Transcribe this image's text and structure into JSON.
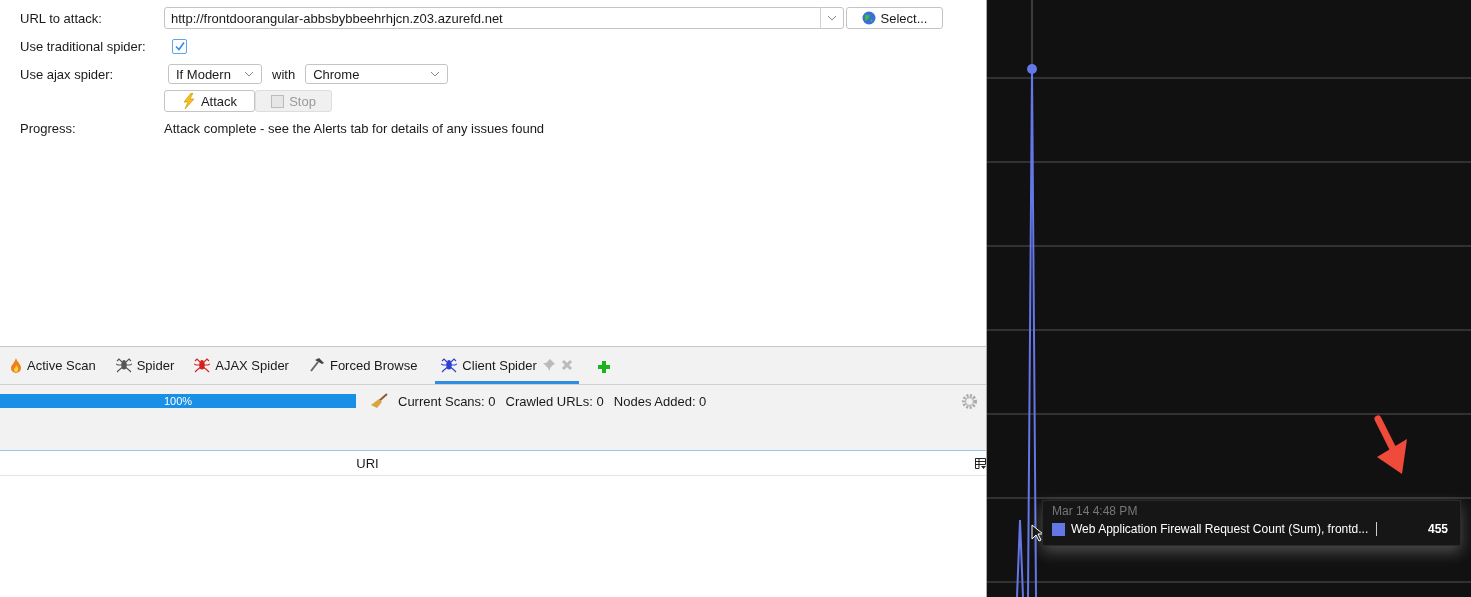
{
  "form": {
    "url_label": "URL to attack:",
    "url_value": "http://frontdoorangular-abbsbybbeehrhjcn.z03.azurefd.net",
    "select_button": "Select...",
    "traditional_label": "Use traditional spider:",
    "traditional_checked": true,
    "ajax_label": "Use ajax spider:",
    "ajax_mode": "If Modern",
    "with_label": "with",
    "browser": "Chrome",
    "attack_button": "Attack",
    "stop_button": "Stop",
    "stop_disabled": true,
    "progress_label": "Progress:",
    "progress_text": "Attack complete - see the Alerts tab for details of any issues found"
  },
  "tabs": [
    {
      "label": "Active Scan",
      "kind": "flame",
      "color": "#f0801a",
      "selected": false
    },
    {
      "label": "Spider",
      "kind": "spider",
      "color": "#555555",
      "selected": false
    },
    {
      "label": "AJAX Spider",
      "kind": "spider",
      "color": "#d42020",
      "selected": false
    },
    {
      "label": "Forced Browse",
      "kind": "hammer",
      "color": "#666666",
      "selected": false
    },
    {
      "label": "Client Spider",
      "kind": "spider",
      "color": "#2b3fd6",
      "selected": true
    }
  ],
  "scan_status": {
    "level": 1,
    "percent": "100%",
    "current_scans": "Current Scans: 0",
    "crawled_urls": "Crawled URLs: 0",
    "nodes_added": "Nodes Added: 0"
  },
  "table": {
    "columns": [
      "URI"
    ]
  },
  "chart_tooltip": {
    "time": "Mar 14 4:48 PM",
    "series": [
      {
        "name": "Web Application Firewall Request Count (Sum), frontd...",
        "value": "455",
        "color": "#6477e6"
      }
    ]
  }
}
